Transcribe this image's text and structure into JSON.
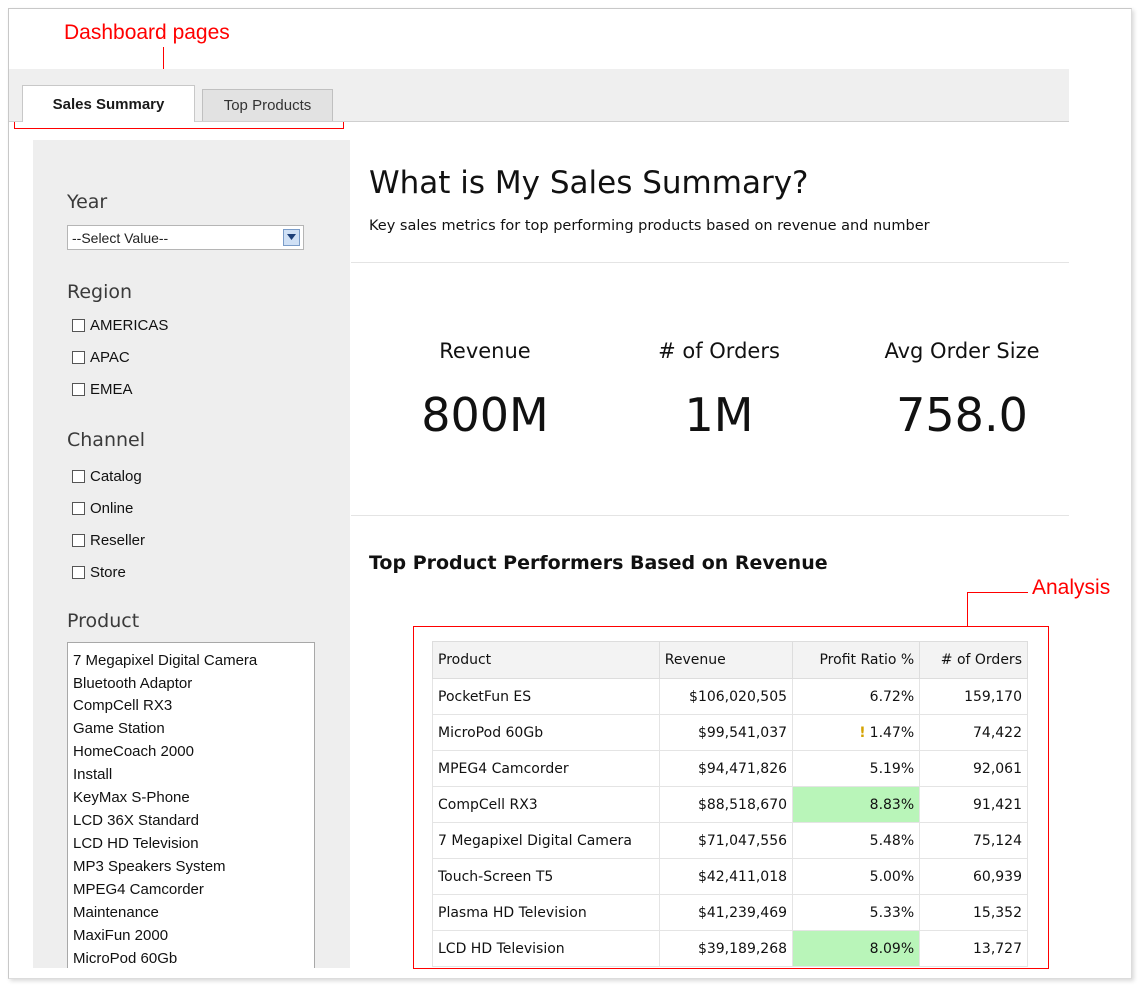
{
  "annotations": {
    "dashboard_pages": "Dashboard pages",
    "analysis": "Analysis"
  },
  "tabs": [
    {
      "label": "Sales Summary",
      "active": true
    },
    {
      "label": "Top Products",
      "active": false
    }
  ],
  "filters": {
    "year": {
      "title": "Year",
      "value": "--Select Value--"
    },
    "region": {
      "title": "Region",
      "options": [
        "AMERICAS",
        "APAC",
        "EMEA"
      ]
    },
    "channel": {
      "title": "Channel",
      "options": [
        "Catalog",
        "Online",
        "Reseller",
        "Store"
      ]
    },
    "product": {
      "title": "Product",
      "items": [
        "7 Megapixel Digital Camera",
        "Bluetooth Adaptor",
        "CompCell RX3",
        "Game Station",
        "HomeCoach 2000",
        "Install",
        "KeyMax S-Phone",
        "LCD 36X Standard",
        "LCD HD Television",
        "MP3 Speakers System",
        "MPEG4 Camcorder",
        "Maintenance",
        "MaxiFun 2000",
        "MicroPod 60Gb"
      ]
    }
  },
  "main": {
    "title": "What is My Sales Summary?",
    "subtitle": "Key sales metrics for top performing products based on revenue and number",
    "kpis": [
      {
        "label": "Revenue",
        "value": "800M"
      },
      {
        "label": "# of Orders",
        "value": "1M"
      },
      {
        "label": "Avg Order Size",
        "value": "758.0"
      }
    ],
    "section_heading": "Top Product Performers Based on Revenue"
  },
  "table": {
    "columns": [
      "Product",
      "Revenue",
      "Profit Ratio %",
      "# of Orders"
    ],
    "rows": [
      {
        "product": "PocketFun ES",
        "revenue": "$106,020,505",
        "profit": "6.72%",
        "orders": "159,170",
        "highlight": false,
        "warning": false
      },
      {
        "product": "MicroPod 60Gb",
        "revenue": "$99,541,037",
        "profit": "1.47%",
        "orders": "74,422",
        "highlight": false,
        "warning": true
      },
      {
        "product": "MPEG4 Camcorder",
        "revenue": "$94,471,826",
        "profit": "5.19%",
        "orders": "92,061",
        "highlight": false,
        "warning": false
      },
      {
        "product": "CompCell RX3",
        "revenue": "$88,518,670",
        "profit": "8.83%",
        "orders": "91,421",
        "highlight": true,
        "warning": false
      },
      {
        "product": "7 Megapixel Digital Camera",
        "revenue": "$71,047,556",
        "profit": "5.48%",
        "orders": "75,124",
        "highlight": false,
        "warning": false
      },
      {
        "product": "Touch-Screen T5",
        "revenue": "$42,411,018",
        "profit": "5.00%",
        "orders": "60,939",
        "highlight": false,
        "warning": false
      },
      {
        "product": "Plasma HD Television",
        "revenue": "$41,239,469",
        "profit": "5.33%",
        "orders": "15,352",
        "highlight": false,
        "warning": false
      },
      {
        "product": "LCD HD Television",
        "revenue": "$39,189,268",
        "profit": "8.09%",
        "orders": "13,727",
        "highlight": true,
        "warning": false
      }
    ]
  },
  "colors": {
    "annotation": "#ff0000",
    "highlight": "#b9f5b9",
    "sidebar_bg": "#eeeeee",
    "tabbar_bg": "#efefef"
  },
  "icons": {
    "dropdown": "chevron-down-icon",
    "warning": "warning-icon"
  }
}
